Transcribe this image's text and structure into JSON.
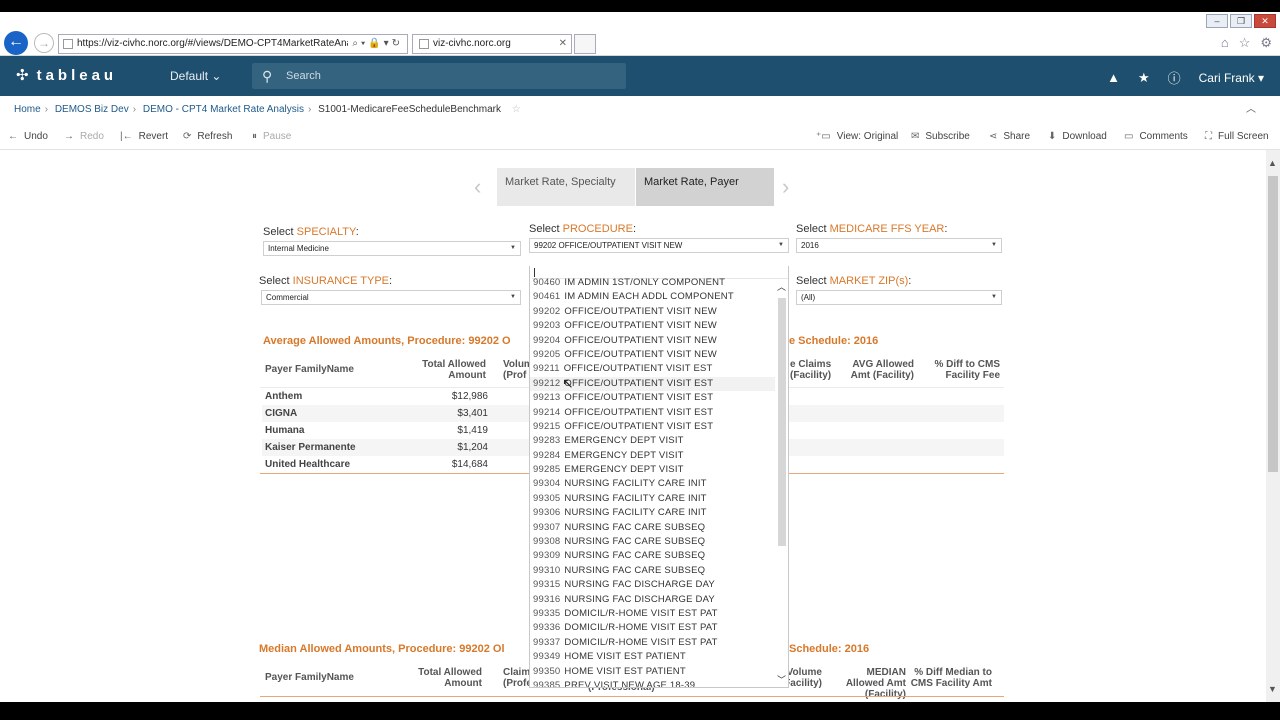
{
  "browser": {
    "url": "https://viz-civhc.norc.org/#/views/DEMO-CPT4MarketRateAnaly",
    "tab_title": "viz-civhc.norc.org"
  },
  "header": {
    "logo": "tableau",
    "site": "Default",
    "search_placeholder": "Search",
    "user": "Cari Frank"
  },
  "breadcrumb": {
    "items": [
      "Home",
      "DEMOS Biz Dev",
      "DEMO - CPT4 Market Rate Analysis"
    ],
    "current": "S1001-MedicareFeeScheduleBenchmark"
  },
  "toolbar": {
    "undo": "Undo",
    "redo": "Redo",
    "revert": "Revert",
    "refresh": "Refresh",
    "pause": "Pause",
    "view_original": "View: Original",
    "subscribe": "Subscribe",
    "share": "Share",
    "download": "Download",
    "comments": "Comments",
    "full_screen": "Full Screen"
  },
  "story": {
    "points": [
      "Market Rate, Specialty",
      "Market Rate, Payer"
    ],
    "active_index": 1
  },
  "filters": {
    "specialty": {
      "prefix": "Select ",
      "hl": "SPECIALTY",
      "suffix": ":",
      "value": "Internal Medicine"
    },
    "procedure": {
      "prefix": "Select ",
      "hl": "PROCEDURE",
      "suffix": ":",
      "value": "99202 OFFICE/OUTPATIENT VISIT NEW"
    },
    "year": {
      "prefix": "Select ",
      "hl": "MEDICARE FFS YEAR",
      "suffix": ":",
      "value": "2016"
    },
    "insurance": {
      "prefix": "Select ",
      "hl": "INSURANCE TYPE",
      "suffix": ":",
      "value": "Commercial"
    },
    "zip": {
      "prefix": "Select ",
      "hl": "MARKET ZIP(s)",
      "suffix": ":",
      "value": "(All)"
    }
  },
  "avg_section": {
    "title_left": "Average Allowed Amounts,  Procedure: 99202 O",
    "title_right": "e Schedule: 2016",
    "headers": {
      "payer": "Payer FamilyName",
      "total": "Total Allowed Amount",
      "vol": "Volum (Prof",
      "claims_fac": "e Claims (Facility)",
      "avg_fac": "AVG Allowed Amt (Facility)",
      "pct": "% Diff to CMS Facility Fee"
    },
    "rows": [
      {
        "payer": "Anthem",
        "total": "$12,986"
      },
      {
        "payer": "CIGNA",
        "total": "$3,401"
      },
      {
        "payer": "Humana",
        "total": "$1,419"
      },
      {
        "payer": "Kaiser Permanente",
        "total": "$1,204"
      },
      {
        "payer": "United Healthcare",
        "total": "$14,684"
      }
    ]
  },
  "median_section": {
    "title_left": "Median Allowed Amounts,  Procedure: 99202 Ol",
    "title_right": "Schedule: 2016",
    "headers": {
      "payer": "Payer FamilyName",
      "total": "Total Allowed Amount",
      "claims": "Claim (Profe",
      "prof": "(Professional)",
      "vol_fac": "Volume Facility)",
      "median_fac": "MEDIAN Allowed Amt (Facility)",
      "pct": "% Diff Median to CMS Facility Amt"
    }
  },
  "procedure_list": [
    {
      "code": "90460",
      "desc": "IM ADMIN 1ST/ONLY COMPONENT"
    },
    {
      "code": "90461",
      "desc": "IM ADMIN EACH ADDL COMPONENT"
    },
    {
      "code": "99202",
      "desc": "OFFICE/OUTPATIENT VISIT NEW"
    },
    {
      "code": "99203",
      "desc": "OFFICE/OUTPATIENT VISIT NEW"
    },
    {
      "code": "99204",
      "desc": "OFFICE/OUTPATIENT VISIT NEW"
    },
    {
      "code": "99205",
      "desc": "OFFICE/OUTPATIENT VISIT NEW"
    },
    {
      "code": "99211",
      "desc": "OFFICE/OUTPATIENT VISIT EST"
    },
    {
      "code": "99212",
      "desc": "OFFICE/OUTPATIENT VISIT EST"
    },
    {
      "code": "99213",
      "desc": "OFFICE/OUTPATIENT VISIT EST"
    },
    {
      "code": "99214",
      "desc": "OFFICE/OUTPATIENT VISIT EST"
    },
    {
      "code": "99215",
      "desc": "OFFICE/OUTPATIENT VISIT EST"
    },
    {
      "code": "99283",
      "desc": "EMERGENCY DEPT VISIT"
    },
    {
      "code": "99284",
      "desc": "EMERGENCY DEPT VISIT"
    },
    {
      "code": "99285",
      "desc": "EMERGENCY DEPT VISIT"
    },
    {
      "code": "99304",
      "desc": "NURSING FACILITY CARE INIT"
    },
    {
      "code": "99305",
      "desc": "NURSING FACILITY CARE INIT"
    },
    {
      "code": "99306",
      "desc": "NURSING FACILITY CARE INIT"
    },
    {
      "code": "99307",
      "desc": "NURSING FAC CARE SUBSEQ"
    },
    {
      "code": "99308",
      "desc": "NURSING FAC CARE SUBSEQ"
    },
    {
      "code": "99309",
      "desc": "NURSING FAC CARE SUBSEQ"
    },
    {
      "code": "99310",
      "desc": "NURSING FAC CARE SUBSEQ"
    },
    {
      "code": "99315",
      "desc": "NURSING FAC DISCHARGE DAY"
    },
    {
      "code": "99316",
      "desc": "NURSING FAC DISCHARGE DAY"
    },
    {
      "code": "99335",
      "desc": "DOMICIL/R-HOME VISIT EST PAT"
    },
    {
      "code": "99336",
      "desc": "DOMICIL/R-HOME VISIT EST PAT"
    },
    {
      "code": "99337",
      "desc": "DOMICIL/R-HOME VISIT EST PAT"
    },
    {
      "code": "99349",
      "desc": "HOME VISIT EST PATIENT"
    },
    {
      "code": "99350",
      "desc": "HOME VISIT EST PATIENT"
    },
    {
      "code": "99385",
      "desc": "PREV VISIT NEW AGE 18-39"
    }
  ],
  "hover_index": 7
}
